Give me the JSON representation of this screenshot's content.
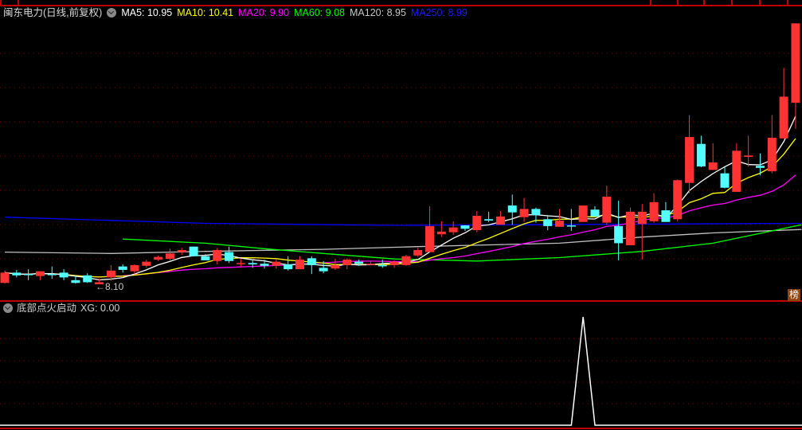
{
  "header": {
    "stock_title": "闽东电力(日线,前复权)",
    "ma_labels": [
      {
        "text": "MA5: 10.95",
        "color": "#ffffff"
      },
      {
        "text": "MA10: 10.41",
        "color": "#ffff00"
      },
      {
        "text": "MA20: 9.90",
        "color": "#ff00ff"
      },
      {
        "text": "MA60: 9.08",
        "color": "#00ff00"
      },
      {
        "text": "MA120: 8.95",
        "color": "#c8c8c8"
      },
      {
        "text": "MA250: 8.99",
        "color": "#1a1aff"
      }
    ]
  },
  "low_marker": "←8.10",
  "badge": "榜",
  "indicator": {
    "title": "底部点火启动",
    "value_label": "XG: 0.00"
  },
  "colors": {
    "up": "#ff3333",
    "down": "#54ffff",
    "grid": "#7a0000",
    "divider": "#c00000",
    "ma5": "#ffffff",
    "ma10": "#ffff00",
    "ma20": "#ff00ff",
    "ma60": "#00ff00",
    "ma120": "#c0c0c0",
    "ma250": "#0000ff",
    "xg": "#ffffff"
  },
  "chart_data": {
    "type": "candlestick",
    "ohlc": [
      [
        8.12,
        8.3,
        8.11,
        8.27
      ],
      [
        8.27,
        8.31,
        8.2,
        8.23
      ],
      [
        8.25,
        8.32,
        8.16,
        8.24
      ],
      [
        8.22,
        8.29,
        8.16,
        8.29
      ],
      [
        8.25,
        8.36,
        8.18,
        8.24
      ],
      [
        8.27,
        8.32,
        8.16,
        8.2
      ],
      [
        8.16,
        8.22,
        8.11,
        8.12
      ],
      [
        8.23,
        8.26,
        8.12,
        8.13
      ],
      [
        8.1,
        8.18,
        8.1,
        8.13
      ],
      [
        8.2,
        8.38,
        8.15,
        8.3
      ],
      [
        8.36,
        8.39,
        8.27,
        8.31
      ],
      [
        8.29,
        8.39,
        8.24,
        8.38
      ],
      [
        8.37,
        8.46,
        8.34,
        8.43
      ],
      [
        8.46,
        8.52,
        8.44,
        8.5
      ],
      [
        8.47,
        8.62,
        8.45,
        8.55
      ],
      [
        8.57,
        8.63,
        8.53,
        8.6
      ],
      [
        8.65,
        8.65,
        8.51,
        8.51
      ],
      [
        8.51,
        8.54,
        8.45,
        8.45
      ],
      [
        8.44,
        8.63,
        8.39,
        8.6
      ],
      [
        8.57,
        8.65,
        8.41,
        8.44
      ],
      [
        8.41,
        8.47,
        8.36,
        8.41
      ],
      [
        8.41,
        8.46,
        8.34,
        8.39
      ],
      [
        8.4,
        8.46,
        8.33,
        8.37
      ],
      [
        8.37,
        8.46,
        8.33,
        8.43
      ],
      [
        8.39,
        8.51,
        8.3,
        8.32
      ],
      [
        8.32,
        8.51,
        8.32,
        8.46
      ],
      [
        8.48,
        8.51,
        8.25,
        8.38
      ],
      [
        8.34,
        8.44,
        8.26,
        8.29
      ],
      [
        8.33,
        8.47,
        8.31,
        8.38
      ],
      [
        8.38,
        8.48,
        8.32,
        8.46
      ],
      [
        8.43,
        8.46,
        8.37,
        8.4
      ],
      [
        8.4,
        8.44,
        8.38,
        8.4
      ],
      [
        8.38,
        8.46,
        8.34,
        8.37
      ],
      [
        8.38,
        8.45,
        8.34,
        8.43
      ],
      [
        8.38,
        8.53,
        8.37,
        8.51
      ],
      [
        8.52,
        8.63,
        8.5,
        8.6
      ],
      [
        8.57,
        9.24,
        8.57,
        8.95
      ],
      [
        8.83,
        9.02,
        8.79,
        8.87
      ],
      [
        8.86,
        9.02,
        8.82,
        8.93
      ],
      [
        8.96,
        8.96,
        8.88,
        8.91
      ],
      [
        8.89,
        9.17,
        8.86,
        9.1
      ],
      [
        9.05,
        9.16,
        9.01,
        9.03
      ],
      [
        8.97,
        9.17,
        8.97,
        9.09
      ],
      [
        9.25,
        9.41,
        8.97,
        9.15
      ],
      [
        9.08,
        9.36,
        9.01,
        9.2
      ],
      [
        9.2,
        9.22,
        9.0,
        9.11
      ],
      [
        9.05,
        9.11,
        8.89,
        8.95
      ],
      [
        8.94,
        9.2,
        8.94,
        9.03
      ],
      [
        8.96,
        9.2,
        8.88,
        8.95
      ],
      [
        9.01,
        9.25,
        9.01,
        9.25
      ],
      [
        9.19,
        9.24,
        9.09,
        9.09
      ],
      [
        9.0,
        9.54,
        8.97,
        9.38
      ],
      [
        8.95,
        9.32,
        8.45,
        8.7
      ],
      [
        8.67,
        9.22,
        8.67,
        9.16
      ],
      [
        8.98,
        9.27,
        8.46,
        9.16
      ],
      [
        9.02,
        9.43,
        9.0,
        9.3
      ],
      [
        9.18,
        9.3,
        9.01,
        9.01
      ],
      [
        9.05,
        9.63,
        9.02,
        9.62
      ],
      [
        9.58,
        10.57,
        9.43,
        10.25
      ],
      [
        10.15,
        10.27,
        9.81,
        9.82
      ],
      [
        9.77,
        10.16,
        9.77,
        9.88
      ],
      [
        9.72,
        9.81,
        9.5,
        9.51
      ],
      [
        9.45,
        10.16,
        9.45,
        10.05
      ],
      [
        9.96,
        10.27,
        9.82,
        9.98
      ],
      [
        9.83,
        10.01,
        9.69,
        9.8
      ],
      [
        9.75,
        10.57,
        9.72,
        10.24
      ],
      [
        10.23,
        11.26,
        10.23,
        10.84
      ],
      [
        10.75,
        11.91,
        10.37,
        11.91
      ]
    ],
    "ma60": [
      [
        10,
        8.76
      ],
      [
        17,
        8.7
      ],
      [
        22,
        8.62
      ],
      [
        27,
        8.55
      ],
      [
        33,
        8.47
      ],
      [
        40,
        8.44
      ],
      [
        47,
        8.49
      ],
      [
        54,
        8.58
      ],
      [
        60,
        8.7
      ],
      [
        67.5,
        8.97
      ]
    ],
    "ma120": [
      [
        0,
        8.57
      ],
      [
        9,
        8.55
      ],
      [
        17,
        8.58
      ],
      [
        27,
        8.61
      ],
      [
        35,
        8.65
      ],
      [
        47,
        8.7
      ],
      [
        54,
        8.79
      ],
      [
        60,
        8.85
      ],
      [
        67.5,
        8.9
      ]
    ],
    "ma250": [
      [
        0,
        9.08
      ],
      [
        17,
        8.99
      ],
      [
        33,
        8.96
      ],
      [
        67.5,
        8.99
      ]
    ],
    "price_low": 8.1,
    "xg": {
      "spike_index": 49,
      "range": [
        0,
        1
      ]
    }
  }
}
